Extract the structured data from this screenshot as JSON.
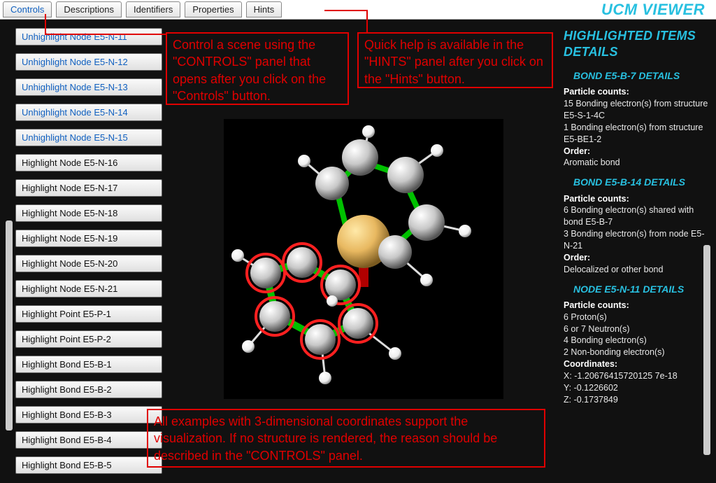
{
  "app_title": "UCM VIEWER",
  "tabs": [
    {
      "label": "Controls",
      "active": true
    },
    {
      "label": "Descriptions",
      "active": false
    },
    {
      "label": "Identifiers",
      "active": false
    },
    {
      "label": "Properties",
      "active": false
    },
    {
      "label": "Hints",
      "active": false
    }
  ],
  "node_buttons": [
    {
      "label": "Unhighlight Node E5-N-11",
      "un": true
    },
    {
      "label": "Unhighlight Node E5-N-12",
      "un": true
    },
    {
      "label": "Unhighlight Node E5-N-13",
      "un": true
    },
    {
      "label": "Unhighlight Node E5-N-14",
      "un": true
    },
    {
      "label": "Unhighlight Node E5-N-15",
      "un": true
    },
    {
      "label": "Highlight Node E5-N-16",
      "un": false
    },
    {
      "label": "Highlight Node E5-N-17",
      "un": false
    },
    {
      "label": "Highlight Node E5-N-18",
      "un": false
    },
    {
      "label": "Highlight Node E5-N-19",
      "un": false
    },
    {
      "label": "Highlight Node E5-N-20",
      "un": false
    },
    {
      "label": "Highlight Node E5-N-21",
      "un": false
    },
    {
      "label": "Highlight Point E5-P-1",
      "un": false
    },
    {
      "label": "Highlight Point E5-P-2",
      "un": false
    },
    {
      "label": "Highlight Bond E5-B-1",
      "un": false
    },
    {
      "label": "Highlight Bond E5-B-2",
      "un": false
    },
    {
      "label": "Highlight Bond E5-B-3",
      "un": false
    },
    {
      "label": "Highlight Bond E5-B-4",
      "un": false
    },
    {
      "label": "Highlight Bond E5-B-5",
      "un": false
    }
  ],
  "right": {
    "title": "HIGHLIGHTED ITEMS DETAILS",
    "sections": [
      {
        "head": "BOND E5-B-7 DETAILS",
        "pc_label": "Particle counts:",
        "lines": [
          "15 Bonding electron(s) from structure E5-S-1-4C",
          "1 Bonding electron(s) from structure E5-BE1-2"
        ],
        "order_label": "Order:",
        "order_value": "Aromatic bond"
      },
      {
        "head": "BOND E5-B-14 DETAILS",
        "pc_label": "Particle counts:",
        "lines": [
          "6 Bonding electron(s) shared with bond E5-B-7",
          "3 Bonding electron(s) from node E5-N-21"
        ],
        "order_label": "Order:",
        "order_value": "Delocalized or other bond"
      },
      {
        "head": "NODE E5-N-11 DETAILS",
        "pc_label": "Particle counts:",
        "lines": [
          "6 Proton(s)",
          "6 or 7 Neutron(s)",
          "4 Bonding electron(s)",
          "2 Non-bonding electron(s)"
        ],
        "coord_label": "Coordinates:",
        "coords": [
          "X: -1.20676415720125 7e-18",
          "Y: -0.1226602",
          "Z: -0.1737849"
        ]
      }
    ]
  },
  "callouts": {
    "c1": "Control a scene using the \"CONTROLS\" panel that opens after you click on the \"Controls\" button.",
    "c2": "Quick help is available in the \"HINTS\" panel after you click on the \"Hints\" button.",
    "c3": "All examples with 3-dimensional coordinates support the visualization. If no structure is rendered, the reason should be described in the \"CONTROLS\" panel."
  }
}
